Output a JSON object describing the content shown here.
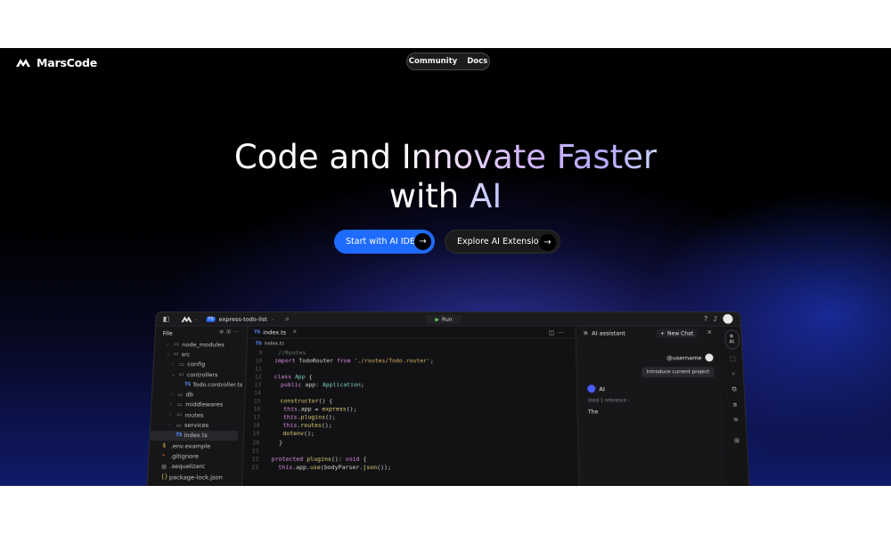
{
  "nav": {
    "brand": "MarsCode",
    "links": [
      "Community",
      "Docs"
    ]
  },
  "hero": {
    "line1_plain": "Code and ",
    "line1_gradient": "Innovate Faster",
    "line2_plain": "with ",
    "line2_gradient": "AI",
    "primary_cta": "Start with AI IDE",
    "secondary_cta": "Explore AI Extension"
  },
  "ide": {
    "project_badge": "TS",
    "project_name": "express-todo-list",
    "run_label": "Run",
    "file_panel_title": "File",
    "files": [
      {
        "name": "node_modules",
        "type": "folder",
        "depth": 1,
        "open": false
      },
      {
        "name": "src",
        "type": "folder",
        "depth": 1,
        "open": true
      },
      {
        "name": "config",
        "type": "folder",
        "depth": 2,
        "open": false
      },
      {
        "name": "controllers",
        "type": "folder",
        "depth": 2,
        "open": true
      },
      {
        "name": "Todo.controller.ts",
        "type": "ts",
        "depth": 3
      },
      {
        "name": "db",
        "type": "folder",
        "depth": 2,
        "open": false
      },
      {
        "name": "middlewares",
        "type": "folder",
        "depth": 2,
        "open": false
      },
      {
        "name": "routes",
        "type": "folder",
        "depth": 2,
        "open": false
      },
      {
        "name": "services",
        "type": "folder",
        "depth": 2,
        "open": false
      },
      {
        "name": "index.ts",
        "type": "ts",
        "depth": 2,
        "selected": true
      },
      {
        "name": ".env.example",
        "type": "s",
        "depth": 0
      },
      {
        "name": ".gitignore",
        "type": "git",
        "depth": 0
      },
      {
        "name": ".sequelizerc",
        "type": "file",
        "depth": 0
      },
      {
        "name": "package-lock.json",
        "type": "json",
        "depth": 0
      }
    ],
    "tab_label": "index.ts",
    "breadcrumb": "index.ts",
    "code_lines": [
      {
        "n": "9",
        "tokens": [
          [
            "cm",
            "  //Routes"
          ]
        ]
      },
      {
        "n": "10",
        "tokens": [
          [
            "kw",
            " import "
          ],
          [
            "id",
            "TodoRouter "
          ],
          [
            "kw",
            "from "
          ],
          [
            "str",
            "'./routes/Todo.router'"
          ],
          [
            "id",
            ";"
          ]
        ]
      },
      {
        "n": "11",
        "tokens": []
      },
      {
        "n": "12",
        "tokens": [
          [
            "kw",
            " class "
          ],
          [
            "ty",
            "App "
          ],
          [
            "id",
            "{"
          ]
        ]
      },
      {
        "n": "13",
        "tokens": [
          [
            "kw",
            "   public "
          ],
          [
            "id",
            "app: "
          ],
          [
            "ty",
            "Application"
          ],
          [
            "id",
            ";"
          ]
        ]
      },
      {
        "n": "14",
        "tokens": []
      },
      {
        "n": "15",
        "tokens": [
          [
            "fn",
            "   constructor"
          ],
          [
            "id",
            "() {"
          ]
        ]
      },
      {
        "n": "16",
        "tokens": [
          [
            "this",
            "    this"
          ],
          [
            "id",
            ".app = "
          ],
          [
            "fn",
            "express"
          ],
          [
            "id",
            "();"
          ]
        ]
      },
      {
        "n": "17",
        "tokens": [
          [
            "this",
            "    this"
          ],
          [
            "id",
            "."
          ],
          [
            "fn",
            "plugins"
          ],
          [
            "id",
            "();"
          ]
        ]
      },
      {
        "n": "18",
        "tokens": [
          [
            "this",
            "    this"
          ],
          [
            "id",
            "."
          ],
          [
            "fn",
            "routes"
          ],
          [
            "id",
            "();"
          ]
        ]
      },
      {
        "n": "19",
        "tokens": [
          [
            "fn",
            "    dotenv"
          ],
          [
            "id",
            "();"
          ]
        ]
      },
      {
        "n": "20",
        "tokens": [
          [
            "id",
            "   }"
          ]
        ]
      },
      {
        "n": "21",
        "tokens": []
      },
      {
        "n": "22",
        "tokens": [
          [
            "kw",
            " protected "
          ],
          [
            "fn",
            "plugins"
          ],
          [
            "id",
            "(): "
          ],
          [
            "kw",
            "void "
          ],
          [
            "id",
            "{"
          ]
        ]
      },
      {
        "n": "23",
        "tokens": [
          [
            "this",
            "   this"
          ],
          [
            "id",
            ".app."
          ],
          [
            "fn",
            "use"
          ],
          [
            "id",
            "(bodyParser."
          ],
          [
            "fn",
            "json"
          ],
          [
            "id",
            "());"
          ]
        ]
      }
    ],
    "ai_panel": {
      "title": "AI assistant",
      "new_chat": "New Chat",
      "username": "@username",
      "user_message": "Introduce current project",
      "ai_name": "AI",
      "reference": "Used 1 reference",
      "reply": "The"
    },
    "rail_ai_label": "AI"
  },
  "colors": {
    "primary": "#1f6bff",
    "ai_accent": "#4a5cff"
  }
}
